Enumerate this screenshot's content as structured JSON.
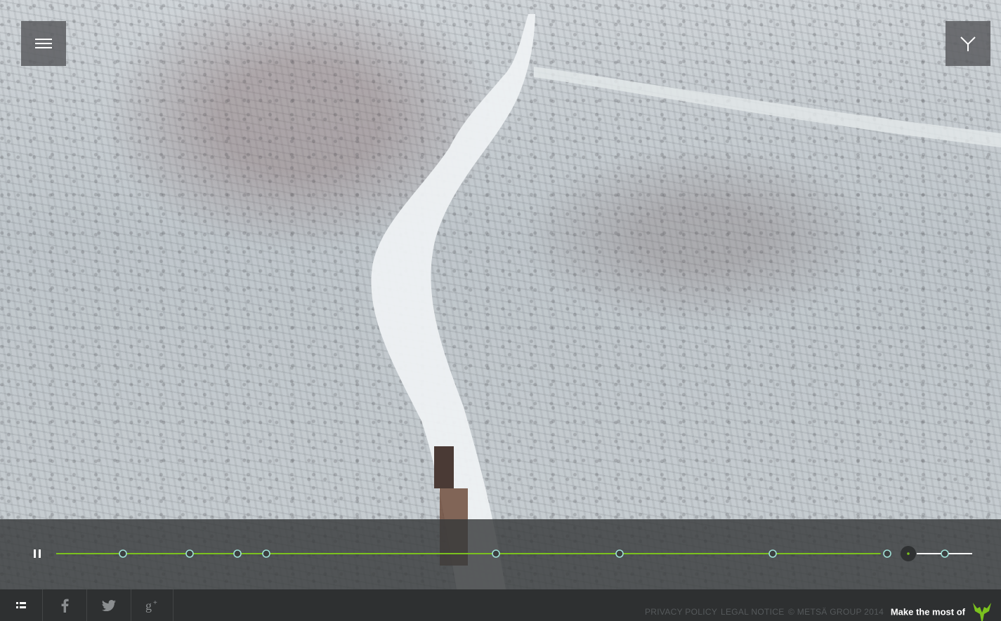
{
  "header": {
    "menu_icon": "hamburger-icon",
    "logo_icon": "metsa-tree-icon"
  },
  "player": {
    "state_icon": "pause-icon",
    "progress_fraction": 0.9,
    "chapters": 10,
    "current_chapter": 9,
    "accent_color": "#7bc21e"
  },
  "footer": {
    "icons": [
      "chapters-icon",
      "facebook-icon",
      "twitter-icon",
      "google-plus-icon"
    ],
    "privacy_policy": "PRIVACY POLICY",
    "legal_notice": "LEGAL NOTICE",
    "copyright": "© METSÄ GROUP 2014",
    "tagline": "Make the most of",
    "brand_icon": "metsa-group-logo-icon",
    "brand_color": "#7bc21e"
  }
}
